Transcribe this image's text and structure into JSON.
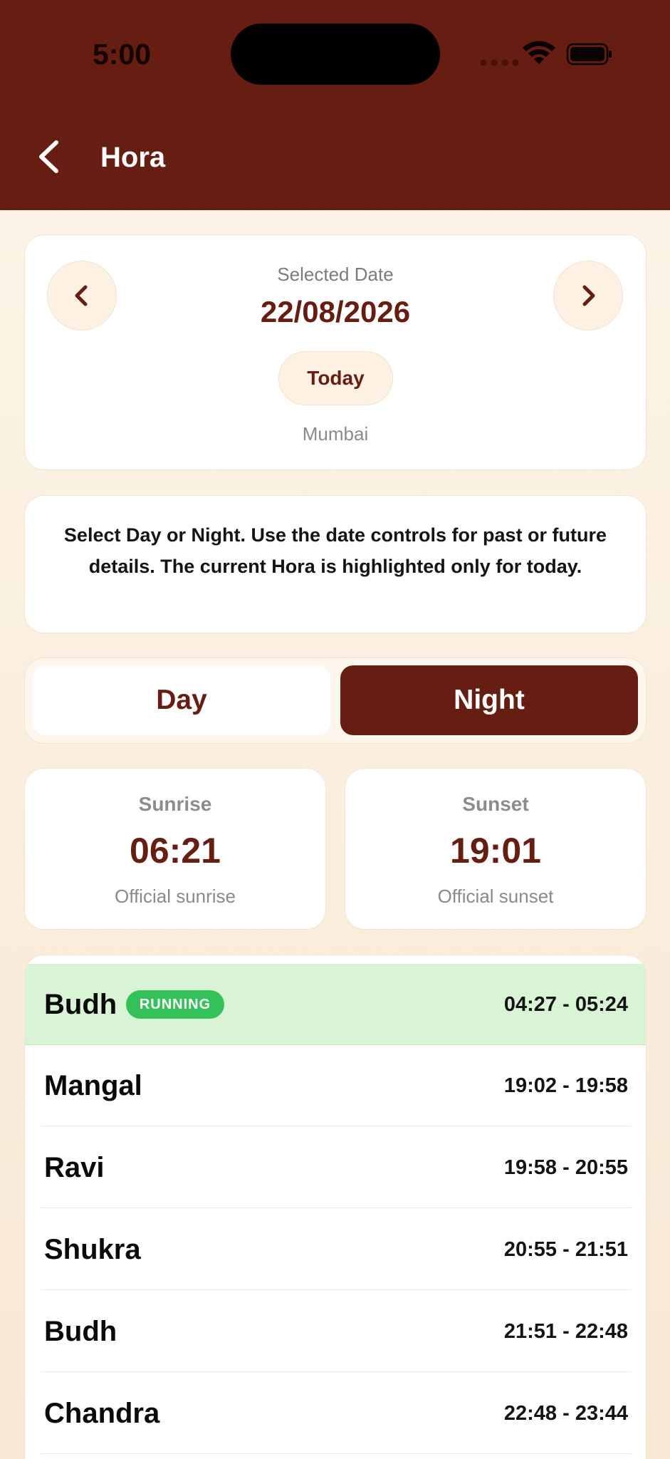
{
  "status_bar": {
    "time": "5:00",
    "icons": [
      "signal-dots-icon",
      "wifi-icon",
      "battery-icon"
    ]
  },
  "header": {
    "back_icon": "chevron-left-icon",
    "title": "Hora"
  },
  "date_selector": {
    "label": "Selected Date",
    "value": "22/08/2026",
    "today_label": "Today",
    "city": "Mumbai"
  },
  "info": {
    "text": "Select Day or Night. Use the date controls for past or future details. The current Hora is highlighted only for today."
  },
  "toggle": {
    "day_label": "Day",
    "night_label": "Night",
    "selected": "Night"
  },
  "sun": {
    "sunrise_label": "Sunrise",
    "sunrise_time": "06:21",
    "sunrise_sub": "Official sunrise",
    "sunset_label": "Sunset",
    "sunset_time": "19:01",
    "sunset_sub": "Official sunset"
  },
  "hora_list": {
    "running_badge": "RUNNING",
    "rows": [
      {
        "name": "Budh",
        "time": "04:27 - 05:24",
        "running": true
      },
      {
        "name": "Mangal",
        "time": "19:02 - 19:58",
        "running": false
      },
      {
        "name": "Ravi",
        "time": "19:58 - 20:55",
        "running": false
      },
      {
        "name": "Shukra",
        "time": "20:55 - 21:51",
        "running": false
      },
      {
        "name": "Budh",
        "time": "21:51 - 22:48",
        "running": false
      },
      {
        "name": "Chandra",
        "time": "22:48 - 23:44",
        "running": false
      }
    ]
  },
  "colors": {
    "primary": "#661d12",
    "running_bg": "#d9f4d5",
    "running_badge": "#34c15a"
  }
}
